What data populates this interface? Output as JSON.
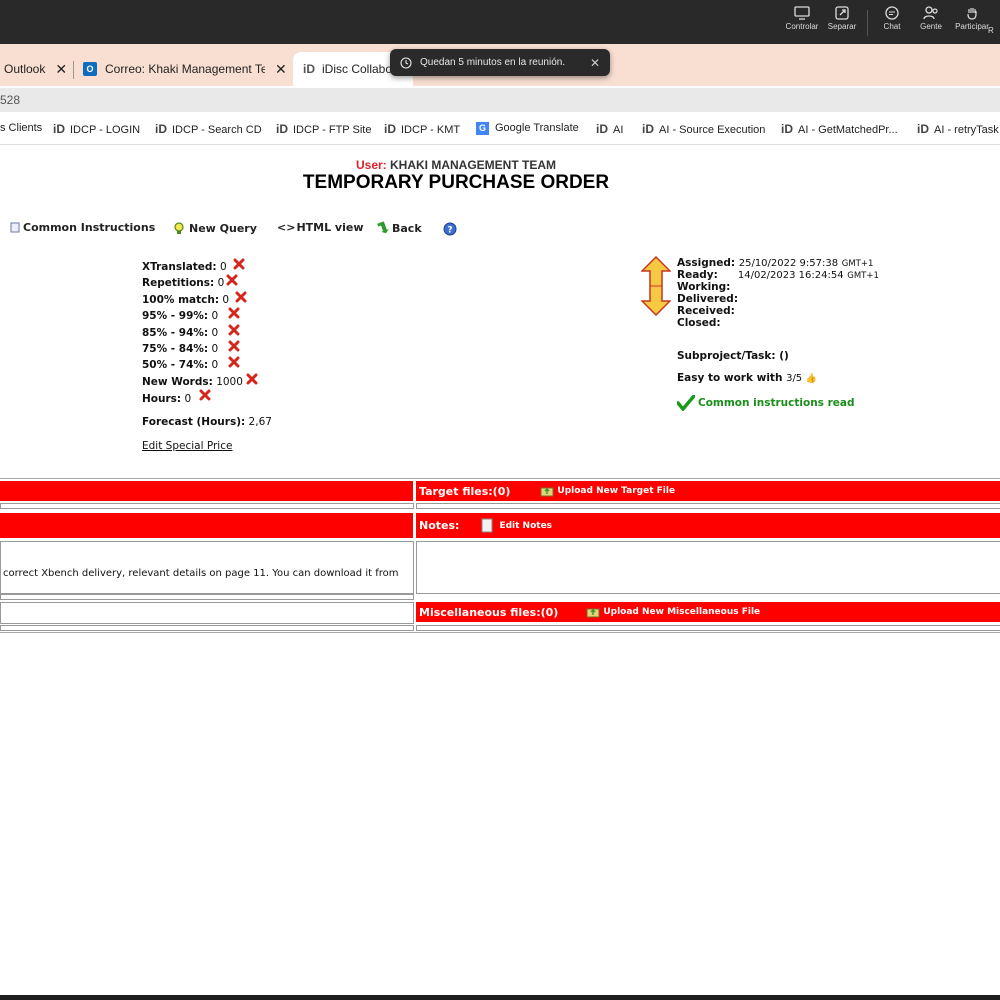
{
  "teams_bar": {
    "buttons": [
      {
        "label": "Controlar",
        "icon": "screen-share-icon"
      },
      {
        "label": "Separar",
        "icon": "pop-out-icon"
      },
      {
        "label": "Chat",
        "icon": "chat-icon"
      },
      {
        "label": "Gente",
        "icon": "people-icon"
      },
      {
        "label": "Participar",
        "icon": "raise-hand-icon"
      },
      {
        "label": "R",
        "icon": ""
      }
    ]
  },
  "tabs": [
    {
      "label": "Outlook"
    },
    {
      "label": "Correo: Khaki Management Team"
    },
    {
      "label": "iDisc Collabo"
    }
  ],
  "toast": {
    "text": "Quedan 5 minutos en la reunión."
  },
  "address": {
    "text": "528"
  },
  "bookmarks": [
    {
      "label": "s Clients"
    },
    {
      "label": "IDCP - LOGIN"
    },
    {
      "label": "IDCP - Search CD"
    },
    {
      "label": "IDCP - FTP Site"
    },
    {
      "label": "IDCP - KMT"
    },
    {
      "label": "Google Translate"
    },
    {
      "label": "AI"
    },
    {
      "label": "AI - Source Execution"
    },
    {
      "label": "AI - GetMatchedPr..."
    },
    {
      "label": "AI - retryTask"
    }
  ],
  "header": {
    "user_label": "User:",
    "user_name": "KHAKI MANAGEMENT TEAM",
    "title": "TEMPORARY PURCHASE ORDER"
  },
  "nav": {
    "common_instructions": "Common Instructions",
    "new_query": "New Query",
    "html_view": "HTML view",
    "back": "Back"
  },
  "stats": [
    {
      "label": "XTranslated:",
      "value": "0"
    },
    {
      "label": "Repetitions:",
      "value": "0"
    },
    {
      "label": "100% match:",
      "value": "0"
    },
    {
      "label": "95% - 99%:",
      "value": "0"
    },
    {
      "label": "85% - 94%:",
      "value": "0"
    },
    {
      "label": "75% - 84%:",
      "value": "0"
    },
    {
      "label": "50% - 74%:",
      "value": "0"
    },
    {
      "label": "New Words:",
      "value": "1000"
    },
    {
      "label": "Hours:",
      "value": "0"
    }
  ],
  "forecast": {
    "label": "Forecast (Hours):",
    "value": "2,67"
  },
  "edit_special_price": "Edit Special Price",
  "dates": {
    "assigned_label": "Assigned:",
    "assigned_value": "25/10/2022 9:57:38",
    "assigned_tz": "GMT+1",
    "ready_label": "Ready:",
    "ready_value": "14/02/2023 16:24:54",
    "ready_tz": "GMT+1",
    "working_label": "Working:",
    "delivered_label": "Delivered:",
    "received_label": "Received:",
    "closed_label": "Closed:"
  },
  "subproject": {
    "label": "Subproject/Task:",
    "value": "()"
  },
  "easy": {
    "label": "Easy to work with",
    "value": "3/5"
  },
  "common_read": "Common instructions read",
  "target": {
    "label": "Target files:(0)",
    "upload": "Upload New Target File"
  },
  "notes": {
    "label": "Notes:",
    "edit": "Edit Notes"
  },
  "instructions_text": "correct Xbench delivery, relevant details on page 11. You can download it from",
  "misc": {
    "label": "Miscellaneous files:(0)",
    "upload": "Upload New Miscellaneous File"
  },
  "colors": {
    "accent_red": "#ff0000",
    "user_red": "#d9232a",
    "green": "#1a8c1a"
  }
}
